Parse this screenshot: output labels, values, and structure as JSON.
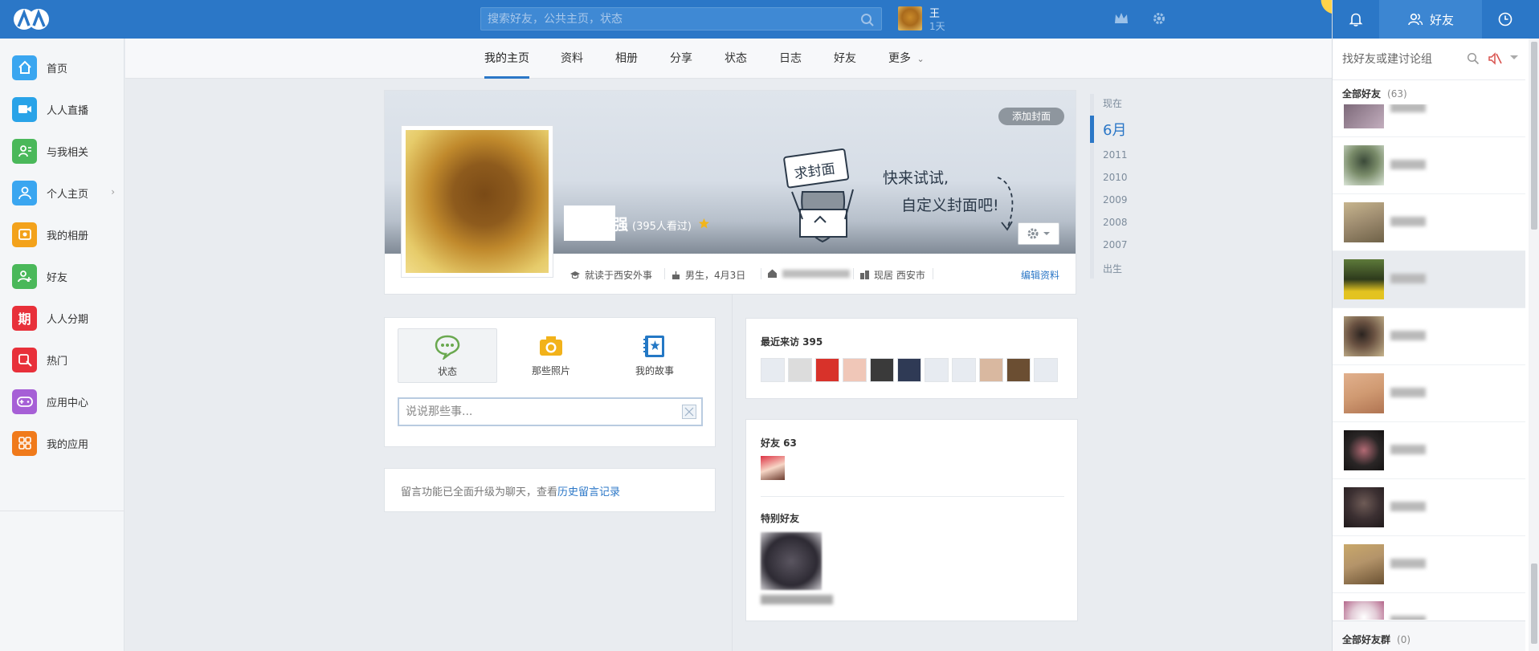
{
  "topbar": {
    "search_placeholder": "搜索好友，公共主页，状态",
    "user_name": "王",
    "user_days": "1天"
  },
  "left_nav": {
    "items": [
      {
        "label": "首页",
        "icon": "home-icon",
        "color": "#3aa6f0"
      },
      {
        "label": "人人直播",
        "icon": "live-camera-icon",
        "color": "#29a3e8"
      },
      {
        "label": "与我相关",
        "icon": "related-icon",
        "color": "#4ab85a"
      },
      {
        "label": "个人主页",
        "icon": "person-icon",
        "color": "#3aa6f0"
      },
      {
        "label": "我的相册",
        "icon": "album-icon",
        "color": "#f3a21b"
      },
      {
        "label": "好友",
        "icon": "friends-icon",
        "color": "#4ab85a"
      },
      {
        "label": "人人分期",
        "icon": "installment-icon",
        "color": "#e8303a",
        "glyph": "期"
      },
      {
        "label": "热门",
        "icon": "hot-icon",
        "color": "#e8303a"
      },
      {
        "label": "应用中心",
        "icon": "gamepad-icon",
        "color": "#a65fd6"
      },
      {
        "label": "我的应用",
        "icon": "apps-grid-icon",
        "color": "#f07a1b"
      }
    ]
  },
  "profile_nav": {
    "tabs": [
      "我的主页",
      "资料",
      "相册",
      "分享",
      "状态",
      "日志",
      "好友",
      "更多"
    ],
    "active": "我的主页"
  },
  "cover": {
    "add_cover_label": "添加封面",
    "view_count": "(395人看过)",
    "name_tail": "强",
    "illustration_sign": "求封面",
    "illustration_line1": "快来试试,",
    "illustration_line2": "自定义封面吧!",
    "info": {
      "school": "就读于西安外事",
      "gender_birthday": "男生，4月3日",
      "hometown": "",
      "residence": "现居 西安市",
      "edit_label": "编辑资料"
    }
  },
  "timeline": {
    "items": [
      "现在",
      "6月",
      "2011",
      "2010",
      "2009",
      "2008",
      "2007",
      "出生"
    ],
    "active": "6月"
  },
  "publisher": {
    "tabs": [
      "状态",
      "那些照片",
      "我的故事"
    ],
    "input_placeholder": "说说那些事..."
  },
  "message": {
    "text": "留言功能已全面升级为聊天，查看",
    "link": "历史留言记录"
  },
  "visitors": {
    "title": "最近来访 395",
    "thumbs": [
      "#e7ebf1",
      "#dcdcdc",
      "#d8322a",
      "#f0c7b8",
      "#3a3a3a",
      "#2f3a55",
      "#e7ebf1",
      "#e7ebf1",
      "#d9b8a0",
      "#6b4e32",
      "#e7ebf1"
    ]
  },
  "friends": {
    "title": "好友 63",
    "special_title": "特别好友"
  },
  "right_panel": {
    "tab_label": "好友",
    "search_placeholder": "找好友或建讨论组",
    "group_title": "全部好友",
    "group_count": "(63)",
    "friend_avatars": [
      "#6b5868",
      "#3b4a39",
      "#9c8a6e",
      "#5e7a3a",
      "#c7b58e",
      "#d09a72",
      "#2a2626",
      "#3c3032",
      "#b4946a",
      "#e2cbd6"
    ],
    "bottom_title": "全部好友群",
    "bottom_count": "(0)"
  }
}
